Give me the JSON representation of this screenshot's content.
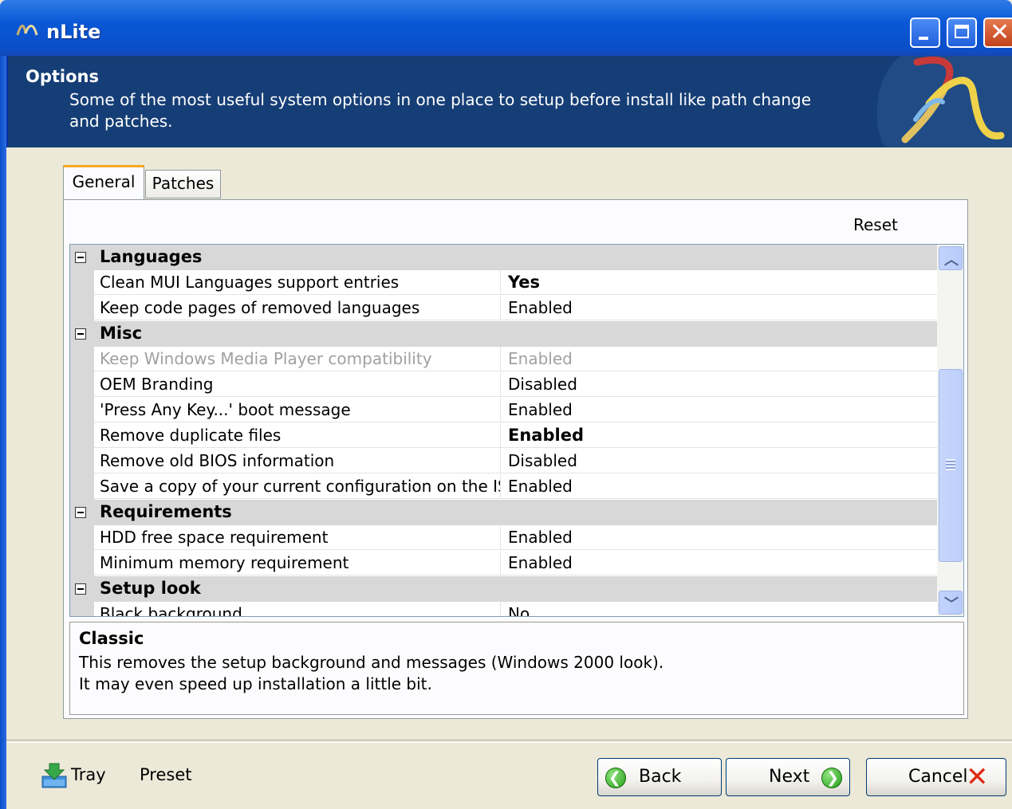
{
  "window": {
    "title": "nLite"
  },
  "header": {
    "title": "Options",
    "description": "Some of the most useful system options in one place to setup before install like path change and patches."
  },
  "tabs": [
    {
      "label": "General",
      "selected": true
    },
    {
      "label": "Patches",
      "selected": false
    }
  ],
  "toolbar": {
    "reset_label": "Reset"
  },
  "grid": {
    "categories": [
      {
        "label": "Languages",
        "items": [
          {
            "name": "Clean MUI Languages support entries",
            "value": "Yes",
            "bold": true
          },
          {
            "name": "Keep code pages of removed languages",
            "value": "Enabled"
          }
        ]
      },
      {
        "label": "Misc",
        "items": [
          {
            "name": "Keep Windows Media Player compatibility",
            "value": "Enabled",
            "disabled": true
          },
          {
            "name": "OEM Branding",
            "value": "Disabled"
          },
          {
            "name": "'Press Any Key...' boot message",
            "value": "Enabled"
          },
          {
            "name": "Remove duplicate files",
            "value": "Enabled",
            "bold": true
          },
          {
            "name": "Remove old BIOS information",
            "value": "Disabled"
          },
          {
            "name": "Save a copy of your current configuration on the ISO",
            "value": "Enabled"
          }
        ]
      },
      {
        "label": "Requirements",
        "items": [
          {
            "name": "HDD free space requirement",
            "value": "Enabled"
          },
          {
            "name": "Minimum memory requirement",
            "value": "Enabled"
          }
        ]
      },
      {
        "label": "Setup look",
        "items": [
          {
            "name": "Black background",
            "value": "No"
          }
        ]
      }
    ]
  },
  "description_box": {
    "title": "Classic",
    "text": "This removes the setup background and messages (Windows 2000 look).\nIt may even speed up installation a little bit."
  },
  "footer": {
    "tray_label": "Tray",
    "preset_label": "Preset",
    "back_label": "Back",
    "next_label": "Next",
    "cancel_label": "Cancel"
  },
  "colors": {
    "titlebar": "#0a58d6",
    "banner": "#163e76",
    "category_bg": "#d8d8d8",
    "cancel_x": "#e02a14"
  }
}
